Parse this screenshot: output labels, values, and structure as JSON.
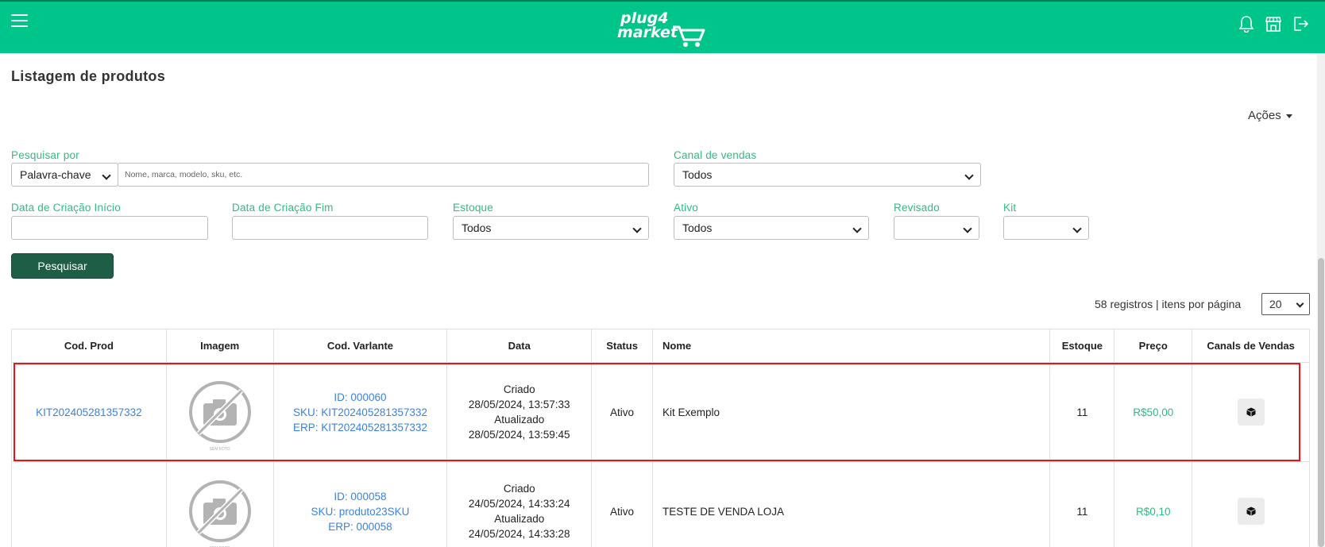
{
  "brand": {
    "logo_line1": "plug4",
    "logo_line2": "market"
  },
  "page": {
    "title": "Listagem de produtos",
    "actions_label": "Ações"
  },
  "filters": {
    "search_by_label": "Pesquisar por",
    "search_by_value": "Palavra-chave",
    "search_placeholder": "Nome, marca, modelo, sku, etc.",
    "channel_label": "Canal de vendas",
    "channel_value": "Todos",
    "created_start_label": "Data de Criação Início",
    "created_end_label": "Data de Criação Fim",
    "stock_label": "Estoque",
    "stock_value": "Todos",
    "active_label": "Ativo",
    "active_value": "Todos",
    "reviewed_label": "Revisado",
    "kit_label": "Kit",
    "search_button": "Pesquisar"
  },
  "pagination": {
    "records_text": "58 registros | itens por página",
    "per_page": "20"
  },
  "table": {
    "headers": [
      "Cod. Prod",
      "Imagem",
      "Cod. Varlante",
      "Data",
      "Status",
      "Nome",
      "Estoque",
      "Preço",
      "Canals de Vendas"
    ],
    "image_caption": "SEM FOTO",
    "rows": [
      {
        "cod_prod": "KIT202405281357332",
        "variant_id": "ID: 000060",
        "variant_sku": "SKU: KIT202405281357332",
        "variant_erp": "ERP: KIT202405281357332",
        "created_label": "Criado",
        "created": "28/05/2024, 13:57:33",
        "updated_label": "Atualizado",
        "updated": "28/05/2024, 13:59:45",
        "status": "Ativo",
        "name": "Kit Exemplo",
        "stock": "11",
        "price": "R$50,00"
      },
      {
        "cod_prod": "",
        "variant_id": "ID: 000058",
        "variant_sku": "SKU: produto23SKU",
        "variant_erp": "ERP: 000058",
        "created_label": "Criado",
        "created": "24/05/2024, 14:33:24",
        "updated_label": "Atualizado",
        "updated": "24/05/2024, 14:33:28",
        "status": "Ativo",
        "name": "TESTE DE VENDA LOJA",
        "stock": "11",
        "price": "R$0,10"
      }
    ]
  },
  "icons": {
    "menu": "hamburger-menu-icon",
    "bell": "bell-icon",
    "store": "store-icon",
    "logout": "logout-icon",
    "channel": "box-icon",
    "no_photo": "no-photo-camera-icon"
  },
  "colors": {
    "header_bg": "#00c58a",
    "label_green": "#2ebd80",
    "button_dark_green": "#1f5e46",
    "link_blue": "#3b82e0",
    "highlight_red": "#e8141a"
  }
}
